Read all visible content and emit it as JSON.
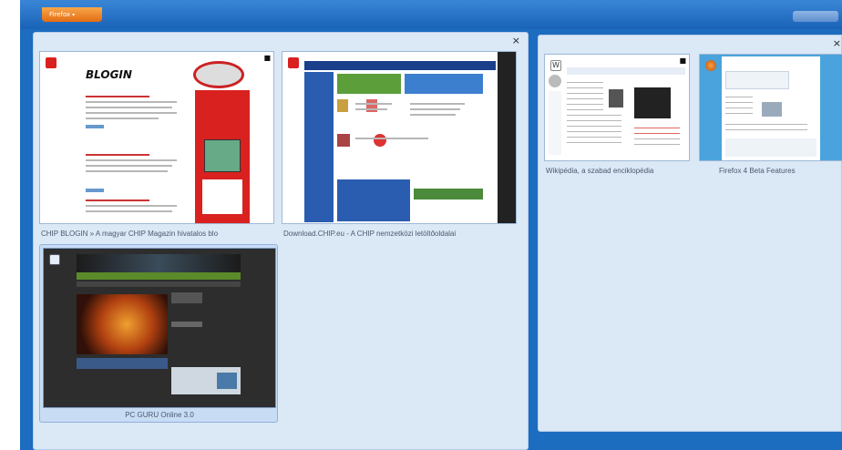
{
  "titlebar": {
    "firefox_menu": "Firefox",
    "menu_arrow": "▾"
  },
  "groups": [
    {
      "close": "×",
      "tabs": [
        {
          "label": "CHIP BLOGIN » A magyar CHIP Magazin hivatalos blo",
          "favicon": "chip-red-icon"
        },
        {
          "label": "Download.CHIP.eu - A CHIP nemzetközi letöltőoldalai",
          "favicon": "chip-red-icon"
        },
        {
          "label": "PC GURU Online 3.0",
          "favicon": "pcguru-icon"
        }
      ],
      "thumb_texts": {
        "blogin_logo": "BLOGIN"
      }
    },
    {
      "close": "×",
      "tabs": [
        {
          "label": "Wikipédia, a szabad enciklopédia",
          "favicon": "wikipedia-icon"
        },
        {
          "label": "Firefox 4 Beta Features",
          "favicon": "firefox-icon"
        }
      ]
    }
  ],
  "colors": {
    "workspace": "#1c6cc0",
    "group_bg": "#dbe8f6",
    "firefox_orange": "#e46c12",
    "chip_red": "#d9211f"
  }
}
